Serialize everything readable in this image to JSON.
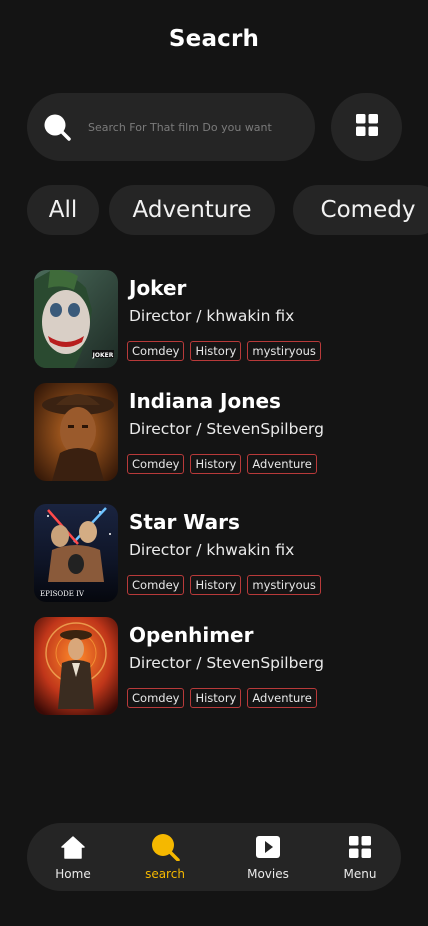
{
  "header": {
    "title": "Seacrh"
  },
  "search": {
    "placeholder": "Search For That film Do you want"
  },
  "categories": [
    "All",
    "Adventure",
    "Comedy"
  ],
  "movies": [
    {
      "title": "Joker",
      "director": "Director / khwakin fix",
      "tags": [
        "Comdey",
        "History",
        "mystiryous"
      ],
      "poster_text": "JOKER"
    },
    {
      "title": "Indiana Jones",
      "director": "Director / StevenSpilberg",
      "tags": [
        "Comdey",
        "History",
        "Adventure"
      ],
      "poster_text": ""
    },
    {
      "title": "Star Wars",
      "director": "Director / khwakin fix",
      "tags": [
        "Comdey",
        "History",
        "mystiryous"
      ],
      "poster_text": "EPISODE IV"
    },
    {
      "title": "Openhimer",
      "director": "Director / StevenSpilberg",
      "tags": [
        "Comdey",
        "History",
        "Adventure"
      ],
      "poster_text": ""
    }
  ],
  "nav": {
    "items": [
      {
        "label": "Home",
        "icon": "home-icon"
      },
      {
        "label": "search",
        "icon": "search-icon",
        "active": true
      },
      {
        "label": "Movies",
        "icon": "play-icon"
      },
      {
        "label": "Menu",
        "icon": "grid-icon"
      }
    ]
  },
  "colors": {
    "background": "#141414",
    "surface": "#252525",
    "accent": "#f5b800",
    "tag_border": "#b83a3a"
  }
}
